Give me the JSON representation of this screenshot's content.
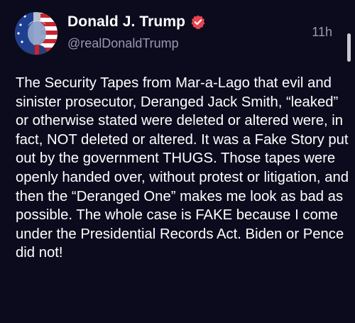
{
  "post": {
    "author": {
      "display_name": "Donald J. Trump",
      "handle": "@realDonaldTrump",
      "verified": true,
      "avatar_icon": "profile-avatar-flag"
    },
    "timestamp": "11h",
    "text": "The Security Tapes from Mar-a-Lago that evil and sinister prosecutor, Deranged Jack Smith, “leaked” or otherwise stated were deleted or altered were, in fact, NOT deleted or altered. It was a Fake Story put out by the government THUGS. Those tapes were openly handed over, without protest or litigation, and then the “Deranged One” makes me look as bad as possible. The whole case is FAKE because I come under the Presidential Records Act. Biden or Pence did not!"
  },
  "colors": {
    "background": "#0c0b1d",
    "text_primary": "#ffffff",
    "text_secondary": "#9a98ae",
    "verified_badge": "#e8434f"
  }
}
